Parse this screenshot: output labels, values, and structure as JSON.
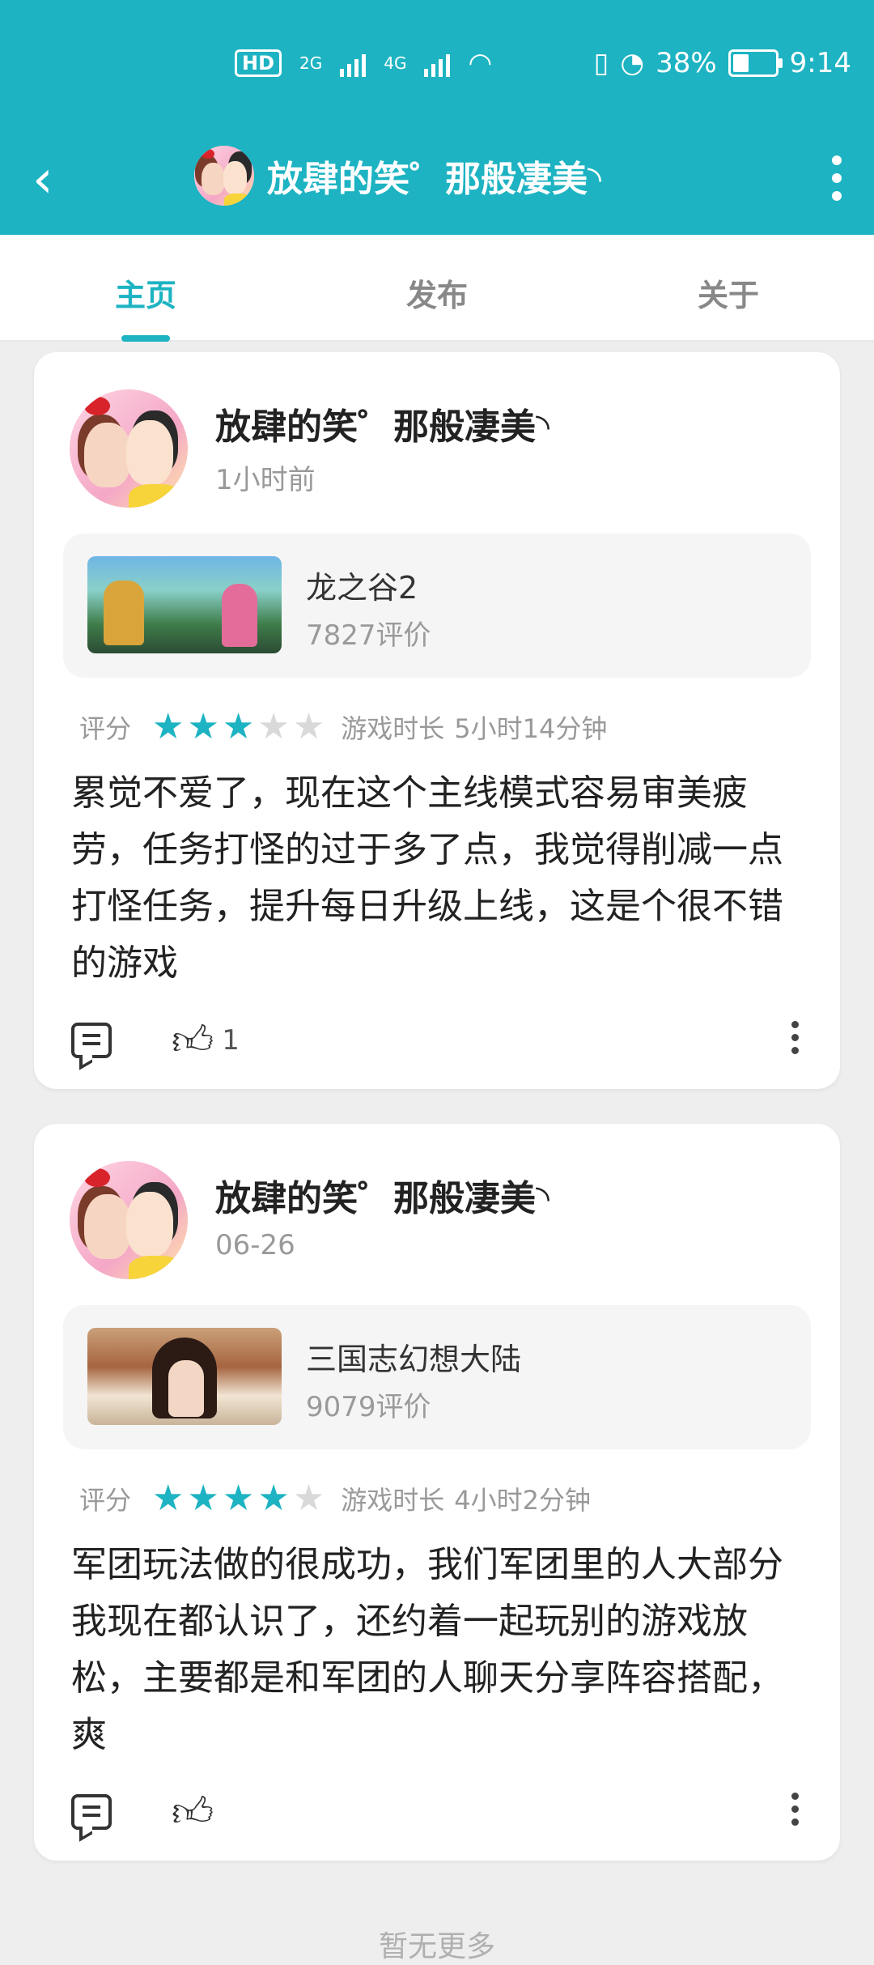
{
  "status_bar": {
    "hd_label": "HD",
    "hd_sub": "2",
    "net1": "2G",
    "net2": "4G",
    "battery_percent": "38%",
    "battery_level": 0.38,
    "time": "9:14"
  },
  "toolbar": {
    "back_glyph": "‹",
    "title": "放肆的笑゜那般凄美◝"
  },
  "tabs": [
    {
      "label": "主页",
      "active": true
    },
    {
      "label": "发布",
      "active": false
    },
    {
      "label": "关于",
      "active": false
    }
  ],
  "posts": [
    {
      "username": "放肆的笑゜那般凄美◝",
      "time": "1小时前",
      "game": {
        "name": "龙之谷2",
        "reviews": "7827评价"
      },
      "rating_label": "评分",
      "stars": 3,
      "playtime_label": "游戏时长",
      "playtime": "5小时14分钟",
      "content": "累觉不爱了，现在这个主线模式容易审美疲劳，任务打怪的过于多了点，我觉得削减一点打怪任务，提升每日升级上线，这是个很不错的游戏",
      "likes": "1"
    },
    {
      "username": "放肆的笑゜那般凄美◝",
      "time": "06-26",
      "game": {
        "name": "三国志幻想大陆",
        "reviews": "9079评价"
      },
      "rating_label": "评分",
      "stars": 4,
      "playtime_label": "游戏时长",
      "playtime": "4小时2分钟",
      "content": "军团玩法做的很成功，我们军团里的人大部分我现在都认识了，还约着一起玩别的游戏放松，主要都是和军团的人聊天分享阵容搭配，爽",
      "likes": ""
    }
  ],
  "footer": {
    "load_more": "暂无更多"
  },
  "colors": {
    "accent": "#1db3c2",
    "background": "#eeeeee"
  }
}
